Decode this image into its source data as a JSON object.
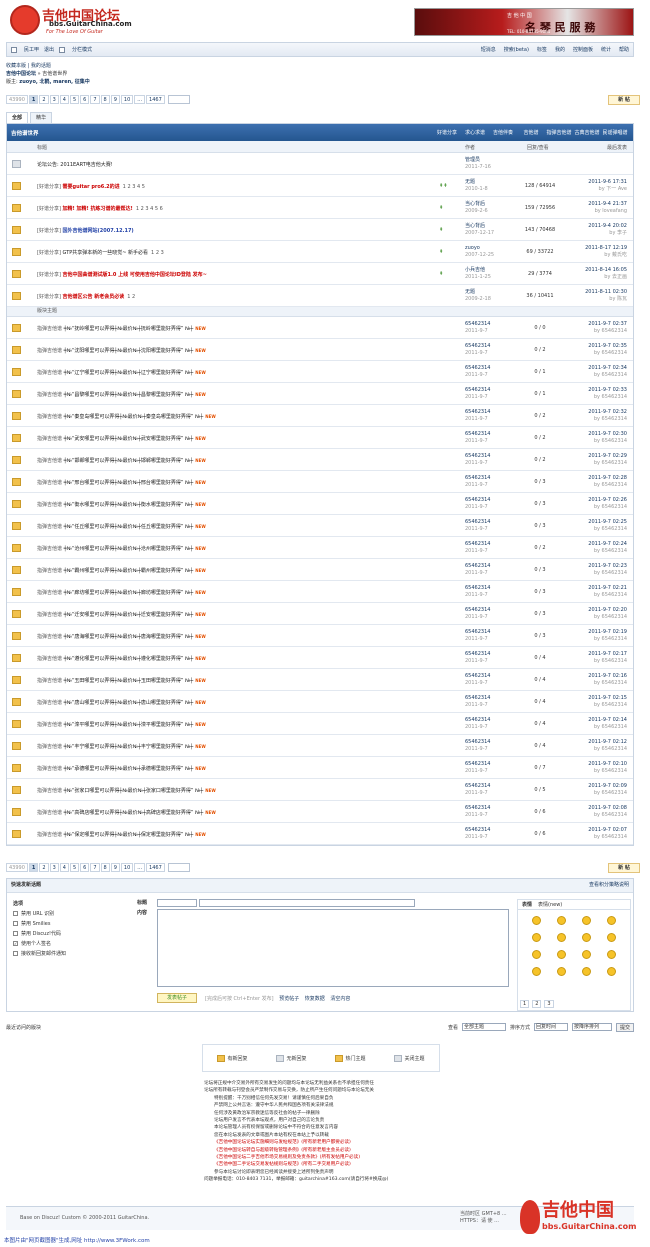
{
  "header": {
    "logo_cn": "吉他中国论坛",
    "logo_url": "bbs.GuitarChina.com",
    "logo_motto": "For The Love Of Guitar",
    "banner_top": "吉 他 中 国",
    "banner_main": "名 琴 民 服 務",
    "banner_phone": "TEL: 010-84735-9181"
  },
  "userbar": {
    "left": [
      "民工甲",
      "退出",
      "分栏模式"
    ],
    "right": [
      "短消息",
      "搜索(beta)",
      "标签",
      "我的",
      "控制面板",
      "统计",
      "帮助"
    ]
  },
  "nav": {
    "links": "收藏本版 | 我的话题",
    "path_root": "吉他中国论坛",
    "path_current": "吉他谱世界",
    "mods_label": "版主:",
    "mods": "zuoyo, 北鹤, maren, 征集中"
  },
  "pager": {
    "total": "43990",
    "pages": [
      "1",
      "2",
      "3",
      "4",
      "5",
      "6",
      "7",
      "8",
      "9",
      "10",
      "...",
      "1467"
    ]
  },
  "new_post": "新 帖",
  "tabs": [
    "全部",
    "精华"
  ],
  "forum": {
    "title": "吉他谱世界",
    "cats": [
      "好谱分享",
      "求心求谱",
      "吉他伴奏",
      "吉他谱",
      "指弹吉他谱",
      "古典吉他谱",
      "民谣弹唱谱"
    ]
  },
  "cols": {
    "title": "标题",
    "author": "作者",
    "stats": "回复/查看",
    "last": "最后发表"
  },
  "sticky": [
    {
      "prefix": "",
      "title": "论坛公告: 2011EART电吉他大赛!",
      "style": "",
      "pages": "",
      "author": "管理员",
      "date": "2011-7-16",
      "stats": "",
      "last": "",
      "by": "",
      "att": "",
      "icon": "grey"
    },
    {
      "prefix": "[好谱分享]",
      "title": "需要guitar pro6.2的进",
      "style": "red",
      "pages": "1 2 3 4 5",
      "author": "无题",
      "date": "2010-1-8",
      "stats": "128 / 64914",
      "last": "2011-9-6 17:31",
      "by": "by 下一 Ave",
      "att": "↟↟",
      "icon": ""
    },
    {
      "prefix": "[好谱分享]",
      "title": "加精! 加精! 抗练习谱的最帮达!",
      "style": "red",
      "pages": "1 2 3 4 5 6",
      "author": "当心背后",
      "date": "2009-2-6",
      "stats": "159 / 72956",
      "last": "2011-9-4 21:37",
      "by": "by loveafang",
      "att": "↟",
      "icon": ""
    },
    {
      "prefix": "[好谱分享]",
      "title": "国外吉他谱网站(2007.12.17)",
      "style": "blue",
      "pages": "",
      "author": "当心背后",
      "date": "2007-12-17",
      "stats": "143 / 70468",
      "last": "2011-9-4 20:02",
      "by": "by 李子",
      "att": "↟",
      "icon": ""
    },
    {
      "prefix": "[好谱分享]",
      "title": "GTP共享弹本新的一些晓觉~ 新手必看",
      "style": "",
      "pages": "1 2 3",
      "author": "zuoyo",
      "date": "2007-12-25",
      "stats": "69 / 33722",
      "last": "2011-8-17 12:19",
      "by": "by 戴氏吃",
      "att": "↟",
      "icon": ""
    },
    {
      "prefix": "[好谱分享]",
      "title": "吉他中国曲谱测试版1.0 上线 可使用吉他中国论坛ID登陆 发布~",
      "style": "red",
      "pages": "",
      "author": "小兵吉他",
      "date": "2011-1-25",
      "stats": "29 / 3774",
      "last": "2011-8-14 16:05",
      "by": "by 去正画",
      "att": "↟",
      "icon": ""
    },
    {
      "prefix": "[好谱分享]",
      "title": "吉他谱区公告 新老会员必读",
      "style": "red",
      "pages": "1 2",
      "author": "无题",
      "date": "2009-2-18",
      "stats": "36 / 10411",
      "last": "2011-8-11 02:30",
      "by": "by 陈瓦",
      "att": "",
      "icon": ""
    }
  ],
  "normal_label": "版块主题",
  "normal": [
    {
      "title": "╪№“抚岭哪里可以弄得┼№最价№┼抚岭哪里能好弄得” №┼",
      "stats": "0 / 0",
      "last": "2011-9-7 02:37"
    },
    {
      "title": "╪№“沈阳哪里可以弄得┼№最价№┼沈阳哪里能好弄得” №┼",
      "stats": "0 / 2",
      "last": "2011-9-7 02:35"
    },
    {
      "title": "╪№“辽宁哪里可以弄得┼№最价№┼辽宁哪里能好弄得” №┼",
      "stats": "0 / 1",
      "last": "2011-9-7 02:34"
    },
    {
      "title": "╪№“昌黎哪里可以弄得┼№最价№┼昌黎哪里能好弄得” №┼",
      "stats": "0 / 1",
      "last": "2011-9-7 02:33"
    },
    {
      "title": "╪№“秦皇岛哪里可以弄得┼№最价№┼秦皇岛哪里能好弄得” №┼",
      "stats": "0 / 2",
      "last": "2011-9-7 02:32"
    },
    {
      "title": "╪№“武安哪里可以弄得┼№最价№┼武安哪里能好弄得” №┼",
      "stats": "0 / 2",
      "last": "2011-9-7 02:30"
    },
    {
      "title": "╪№“邯郸哪里可以弄得┼№最价№┼邯郸哪里能好弄得” №┼",
      "stats": "0 / 2",
      "last": "2011-9-7 02:29"
    },
    {
      "title": "╪№“邢台哪里可以弄得┼№最价№┼邢台哪里能好弄得” №┼",
      "stats": "0 / 3",
      "last": "2011-9-7 02:28"
    },
    {
      "title": "╪№“衡水哪里可以弄得┼№最价№┼衡水哪里能好弄得” №┼",
      "stats": "0 / 3",
      "last": "2011-9-7 02:26"
    },
    {
      "title": "╪№“任丘哪里可以弄得┼№最价№┼任丘哪里能好弄得” №┼",
      "stats": "0 / 3",
      "last": "2011-9-7 02:25"
    },
    {
      "title": "╪№“沧州哪里可以弄得┼№最价№┼沧州哪里能好弄得” №┼",
      "stats": "0 / 2",
      "last": "2011-9-7 02:24"
    },
    {
      "title": "╪№“霸州哪里可以弄得┼№最价№┼霸州哪里能好弄得” №┼",
      "stats": "0 / 3",
      "last": "2011-9-7 02:23"
    },
    {
      "title": "╪№“廊坊哪里可以弄得┼№最价№┼廊坊哪里能好弄得” №┼",
      "stats": "0 / 3",
      "last": "2011-9-7 02:21"
    },
    {
      "title": "╪№“迁安哪里可以弄得┼№最价№┼迁安哪里能好弄得” №┼",
      "stats": "0 / 3",
      "last": "2011-9-7 02:20"
    },
    {
      "title": "╪№“唐海哪里可以弄得┼№最价№┼唐海哪里能好弄得” №┼",
      "stats": "0 / 3",
      "last": "2011-9-7 02:19"
    },
    {
      "title": "╪№“遵化哪里可以弄得┼№最价№┼遵化哪里能好弄得” №┼",
      "stats": "0 / 4",
      "last": "2011-9-7 02:17"
    },
    {
      "title": "╪№“玉田哪里可以弄得┼№最价№┼玉田哪里能好弄得” №┼",
      "stats": "0 / 4",
      "last": "2011-9-7 02:16"
    },
    {
      "title": "╪№“唐山哪里可以弄得┼№最价№┼唐山哪里能好弄得” №┼",
      "stats": "0 / 4",
      "last": "2011-9-7 02:15"
    },
    {
      "title": "╪№“滦平哪里可以弄得┼№最价№┼滦平哪里能好弄得” №┼",
      "stats": "0 / 4",
      "last": "2011-9-7 02:14"
    },
    {
      "title": "╪№“丰宁哪里可以弄得┼№最价№┼丰宁哪里能好弄得” №┼",
      "stats": "0 / 4",
      "last": "2011-9-7 02:12"
    },
    {
      "title": "╪№“承德哪里可以弄得┼№最价№┼承德哪里能好弄得” №┼",
      "stats": "0 / 7",
      "last": "2011-9-7 02:10"
    },
    {
      "title": "╪№“张家口哪里可以弄得┼№最价№┼张家口哪里能好弄得” №┼",
      "stats": "0 / 5",
      "last": "2011-9-7 02:09"
    },
    {
      "title": "╪№“高碑店哪里可以弄得┼№最价№┼高碑店哪里能好弄得” №┼",
      "stats": "0 / 6",
      "last": "2011-9-7 02:08"
    },
    {
      "title": "╪№“保定哪里可以弄得┼№最价№┼保定哪里能好弄得” №┼",
      "stats": "0 / 6",
      "last": "2011-9-7 02:07"
    }
  ],
  "normal_author": "65462314",
  "normal_date": "2011-9-7",
  "normal_by": "by 65462314",
  "new_badge": "NEW",
  "quickpost": {
    "title": "快速发新话题",
    "help": "查看积分策略说明",
    "opts_label": "选项",
    "opts": [
      {
        "label": "禁用 URL 识别",
        "checked": false
      },
      {
        "label": "禁用 Smilies",
        "checked": false
      },
      {
        "label": "禁用 Discuz!代码",
        "checked": false
      },
      {
        "label": "使用个人签名",
        "checked": true
      },
      {
        "label": "接收新回复邮件通知",
        "checked": false
      }
    ],
    "subject_label": "标题",
    "content_label": "内容",
    "submit": "发表帖子",
    "tip": "[完成后可按 Ctrl+Enter 发布]",
    "preview": "预览帖子",
    "clear": "恢复数据",
    "clear2": "清空内容",
    "smile_tabs": [
      "表情",
      "表情(new)"
    ],
    "smile_pages": [
      "1",
      "2",
      "3"
    ]
  },
  "bottombar": {
    "recent": "最近访问的版块",
    "view_label": "查看",
    "view": "全部主题",
    "sort_label": "排序方式",
    "sort": "回复时间",
    "order": "按降序排列",
    "go": "提交"
  },
  "legend": [
    "有新回复",
    "无新回复",
    "热门主题",
    "关闭主题"
  ],
  "rules": [
    {
      "t": "论坛将正规中介交易外所有交易发生的问题均与本论坛无利益关系也不承担任何责任",
      "r": false
    },
    {
      "t": "论坛所有转载与刊登会员严禁制作交易与交换，防止所产生任何问题均与本论坛无关",
      "r": false
    },
    {
      "t": "特别提醒：千万别相信任何先发交易！请谨慎任何后果自负",
      "r": false
    },
    {
      "t": "严禁网上公共言语：遵守中华人民共和国各项有关法律法规",
      "r": false
    },
    {
      "t": "任何涉及黄政治军宗教迷信等反社会的帖子一律删除",
      "r": false
    },
    {
      "t": "论坛用户发言不代表本坛观点，用户对自己的言论负责",
      "r": false
    },
    {
      "t": "本论坛管理人员有权保留或删除论坛中不符合的任意发言内容",
      "r": false
    },
    {
      "t": "您在本论坛发表的文章或图片本站有权在本站上予以转载",
      "r": false
    },
    {
      "t": "《吉他中国论坛论坛实施细则与发帖规范》(所有新老用户都要必读)",
      "r": true
    },
    {
      "t": "《吉他中国论坛转自与超级转贴管理条例》(所有新老版主会员必读)",
      "r": true
    },
    {
      "t": "《吉他中国论坛二手吉他市场交易规则及免责条款》(所有发帖用户必读)",
      "r": true
    },
    {
      "t": "《吉他中国二手论坛交易发帖规则与规范》(所有二手交易用户必读)",
      "r": true
    },
    {
      "t": "参与本论坛讨论即表明您已经阅读并接受上述所列免责声明",
      "r": false
    },
    {
      "t": "问题举报电话：010-8403 7131，举报邮箱：guitarchina#163.com(请自行将#换成@)",
      "r": false
    }
  ],
  "footer": {
    "based": "Base on Discuz! Custom © 2000-2011 GuitarChina.",
    "right1": "当前时区 GMT+8 ...",
    "right2": "HTTPS：请 使 ..."
  },
  "watermark": {
    "cn": "吉他中国",
    "url": "bbs.GuitarChina.com"
  },
  "bottom_note": "本图片由\"网页截图器\"生成,网址 http://www.3FWork.com"
}
